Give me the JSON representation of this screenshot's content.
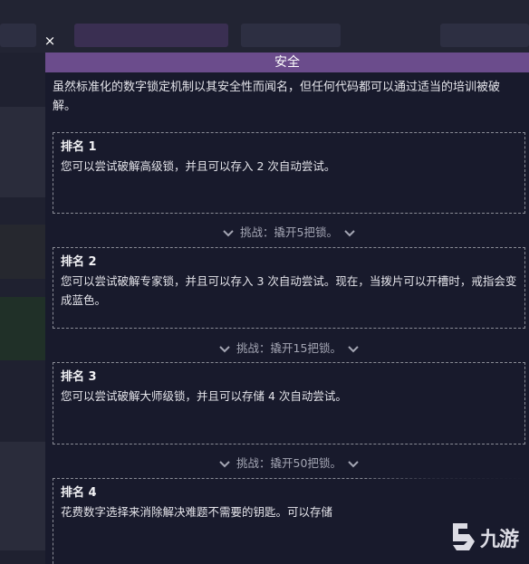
{
  "dialog": {
    "close_glyph": "×",
    "title": "安全",
    "intro": "虽然标准化的数字锁定机制以其安全性而闻名，但任何代码都可以通过适当的培训被破解。"
  },
  "ranks": [
    {
      "title": "排名 1",
      "description": "您可以尝试破解高级锁，并且可以存入 2 次自动尝试。"
    },
    {
      "title": "排名 2",
      "description": "您可以尝试破解专家锁，并且可以存入 3 次自动尝试。现在，当拨片可以开槽时，戒指会变成蓝色。"
    },
    {
      "title": "排名 3",
      "description": "您可以尝试破解大师级锁，并且可以存储 4 次自动尝试。"
    },
    {
      "title": "排名 4",
      "description": "花费数字选择来消除解决难题不需要的钥匙。可以存储"
    }
  ],
  "challenges": [
    "挑战：撬开5把锁。",
    "挑战：撬开15把锁。",
    "挑战：撬开50把锁。"
  ],
  "watermark": {
    "text": "九游"
  },
  "colors": {
    "header": "#6b4c8c",
    "panel": "#181a2c",
    "border": "#8a8c96"
  },
  "icons": {
    "close": "close-icon",
    "chevron": "chevron-down-icon",
    "logo": "jiuyou-logo"
  }
}
